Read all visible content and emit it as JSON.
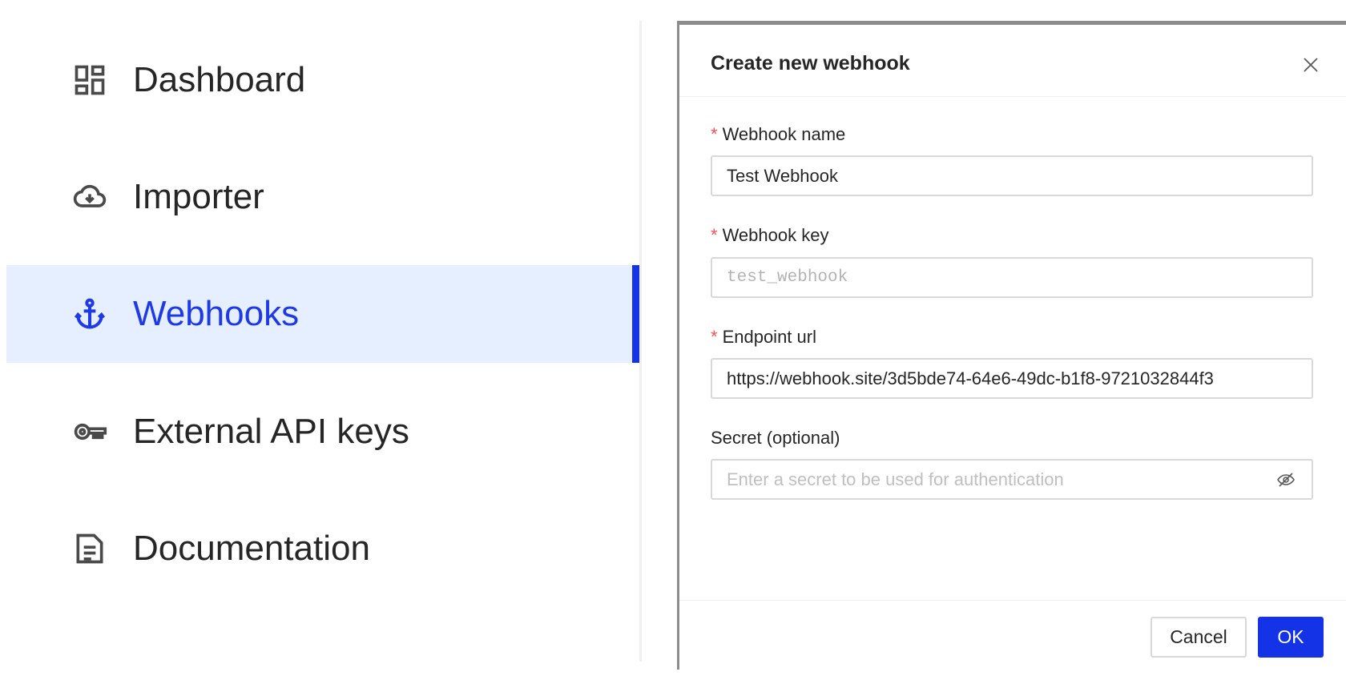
{
  "sidebar": {
    "items": [
      {
        "label": "Dashboard",
        "icon": "dashboard-icon"
      },
      {
        "label": "Importer",
        "icon": "cloud-download-icon"
      },
      {
        "label": "Webhooks",
        "icon": "anchor-icon",
        "active": true
      },
      {
        "label": "External API keys",
        "icon": "key-icon"
      },
      {
        "label": "Documentation",
        "icon": "document-icon"
      }
    ]
  },
  "modal": {
    "title": "Create new webhook",
    "close_icon": "close-icon",
    "fields": {
      "name": {
        "label": "Webhook name",
        "required": "*",
        "value": "Test Webhook"
      },
      "key": {
        "label": "Webhook key",
        "required": "*",
        "value": "test_webhook"
      },
      "url": {
        "label": "Endpoint url",
        "required": "*",
        "value": "https://webhook.site/3d5bde74-64e6-49dc-b1f8-9721032844f3"
      },
      "secret": {
        "label": "Secret (optional)",
        "placeholder": "Enter a secret to be used for authentication",
        "icon": "eye-invisible-icon"
      }
    },
    "footer": {
      "cancel_label": "Cancel",
      "ok_label": "OK"
    }
  },
  "colors": {
    "accent": "#1432e6",
    "active_bg": "#e6efff",
    "required": "#ff4d4f"
  }
}
